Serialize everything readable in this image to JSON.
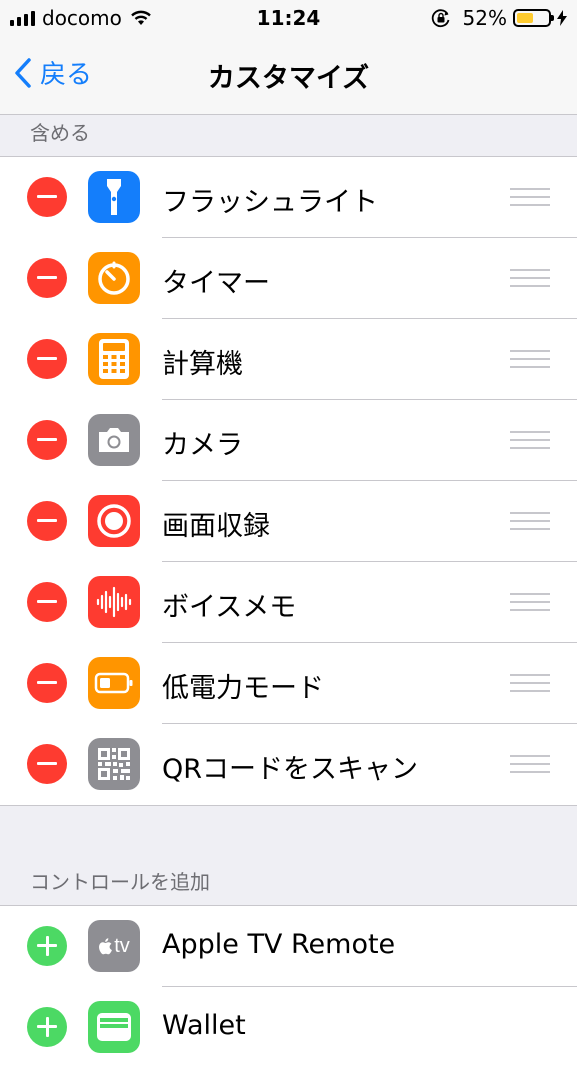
{
  "status": {
    "carrier": "docomo",
    "time": "11:24",
    "battery_percent_text": "52%",
    "battery_level": 0.52
  },
  "nav": {
    "back_label": "戻る",
    "title": "カスタマイズ"
  },
  "included": {
    "header": "含める",
    "items": [
      {
        "label": "フラッシュライト",
        "icon": "flashlight-icon",
        "color": "#147efb"
      },
      {
        "label": "タイマー",
        "icon": "timer-icon",
        "color": "#ff9500"
      },
      {
        "label": "計算機",
        "icon": "calculator-icon",
        "color": "#ff9500"
      },
      {
        "label": "カメラ",
        "icon": "camera-icon",
        "color": "#8e8e93"
      },
      {
        "label": "画面収録",
        "icon": "screen-recording-icon",
        "color": "#fe3b30"
      },
      {
        "label": "ボイスメモ",
        "icon": "voice-memo-icon",
        "color": "#fe3b30"
      },
      {
        "label": "低電力モード",
        "icon": "low-power-icon",
        "color": "#ff9500"
      },
      {
        "label": "QRコードをスキャン",
        "icon": "qr-code-icon",
        "color": "#8e8e93"
      }
    ]
  },
  "more": {
    "header": "コントロールを追加",
    "items": [
      {
        "label": "Apple TV Remote",
        "icon": "apple-tv-icon",
        "color": "#8e8e93",
        "icon_text": "tv"
      },
      {
        "label": "Wallet",
        "icon": "wallet-icon",
        "color": "#4cd964"
      }
    ]
  }
}
